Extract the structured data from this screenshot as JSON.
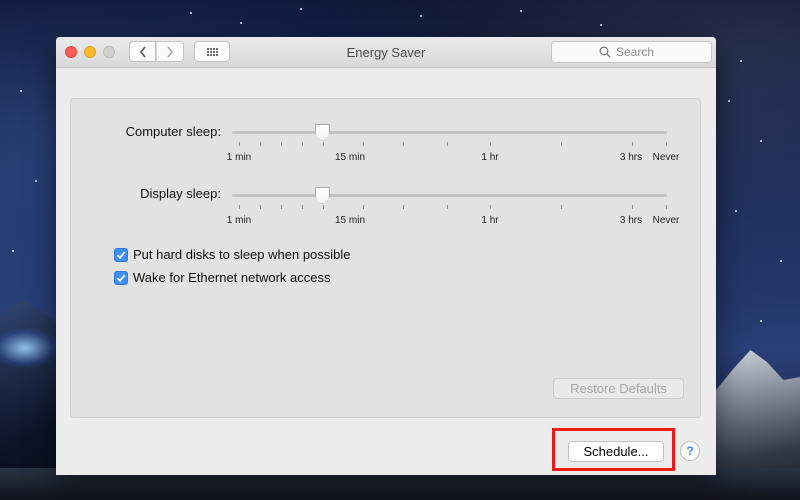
{
  "window": {
    "title": "Energy Saver",
    "search_placeholder": "Search"
  },
  "sliders": [
    {
      "label": "Computer sleep:",
      "value": "15 min",
      "tick_labels": [
        "1 min",
        "15 min",
        "1 hr",
        "3 hrs",
        "Never"
      ]
    },
    {
      "label": "Display sleep:",
      "value": "15 min",
      "tick_labels": [
        "1 min",
        "15 min",
        "1 hr",
        "3 hrs",
        "Never"
      ]
    }
  ],
  "checkboxes": [
    {
      "label": "Put hard disks to sleep when possible",
      "checked": true
    },
    {
      "label": "Wake for Ethernet network access",
      "checked": true
    }
  ],
  "buttons": {
    "restore_defaults": "Restore Defaults",
    "schedule": "Schedule...",
    "help": "?"
  },
  "colors": {
    "accent": "#3f8ff5",
    "highlight": "#ee1b1b",
    "close": "#fc5f57",
    "minimize": "#fdbc2e"
  }
}
